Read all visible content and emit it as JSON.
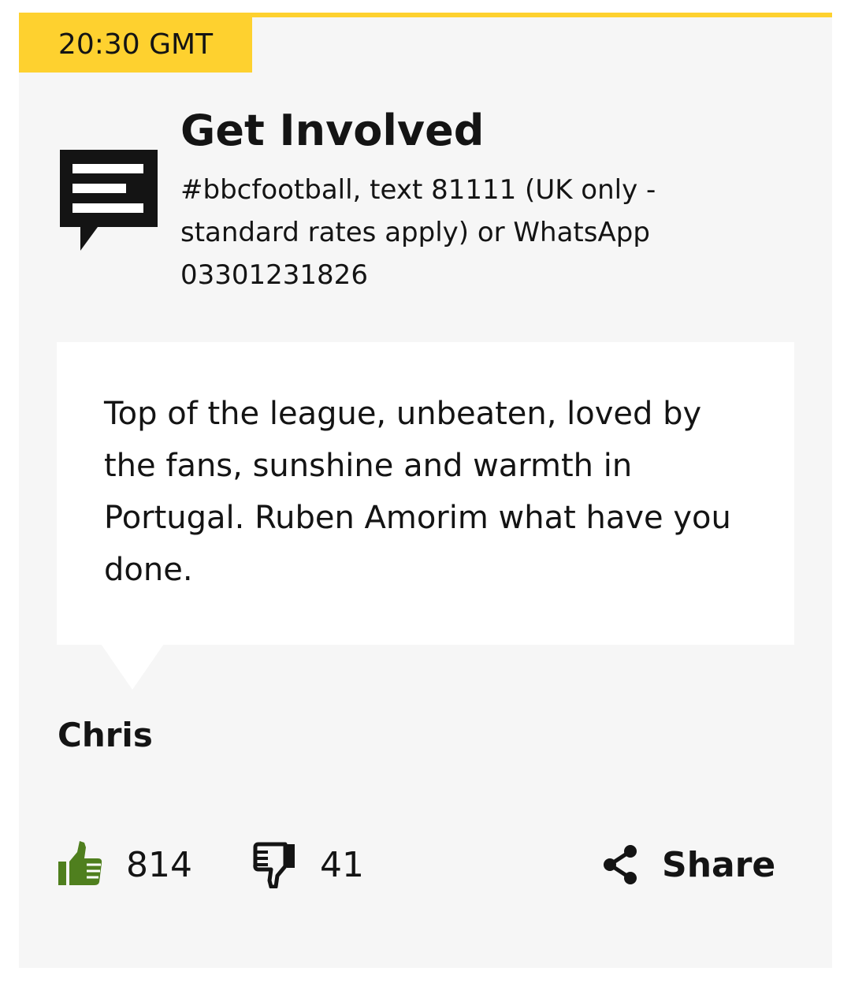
{
  "post": {
    "timestamp": "20:30 GMT"
  },
  "get_involved": {
    "icon": "comment-icon",
    "title": "Get Involved",
    "description": "#bbcfootball, text 81111 (UK only - standard rates apply) or WhatsApp 03301231826"
  },
  "comment": {
    "text": "Top of the league, unbeaten, loved by the fans, sunshine and warmth in Portugal. Ruben Amorim what have you done.",
    "author": "Chris"
  },
  "reactions": {
    "like_icon": "thumbs-up-icon",
    "like_count": "814",
    "like_color": "#4f7f1e",
    "dislike_icon": "thumbs-down-icon",
    "dislike_count": "41",
    "share_icon": "share-icon",
    "share_label": "Share"
  },
  "colors": {
    "accent": "#fed12f",
    "card_background": "#f6f6f6",
    "text": "#141414"
  }
}
